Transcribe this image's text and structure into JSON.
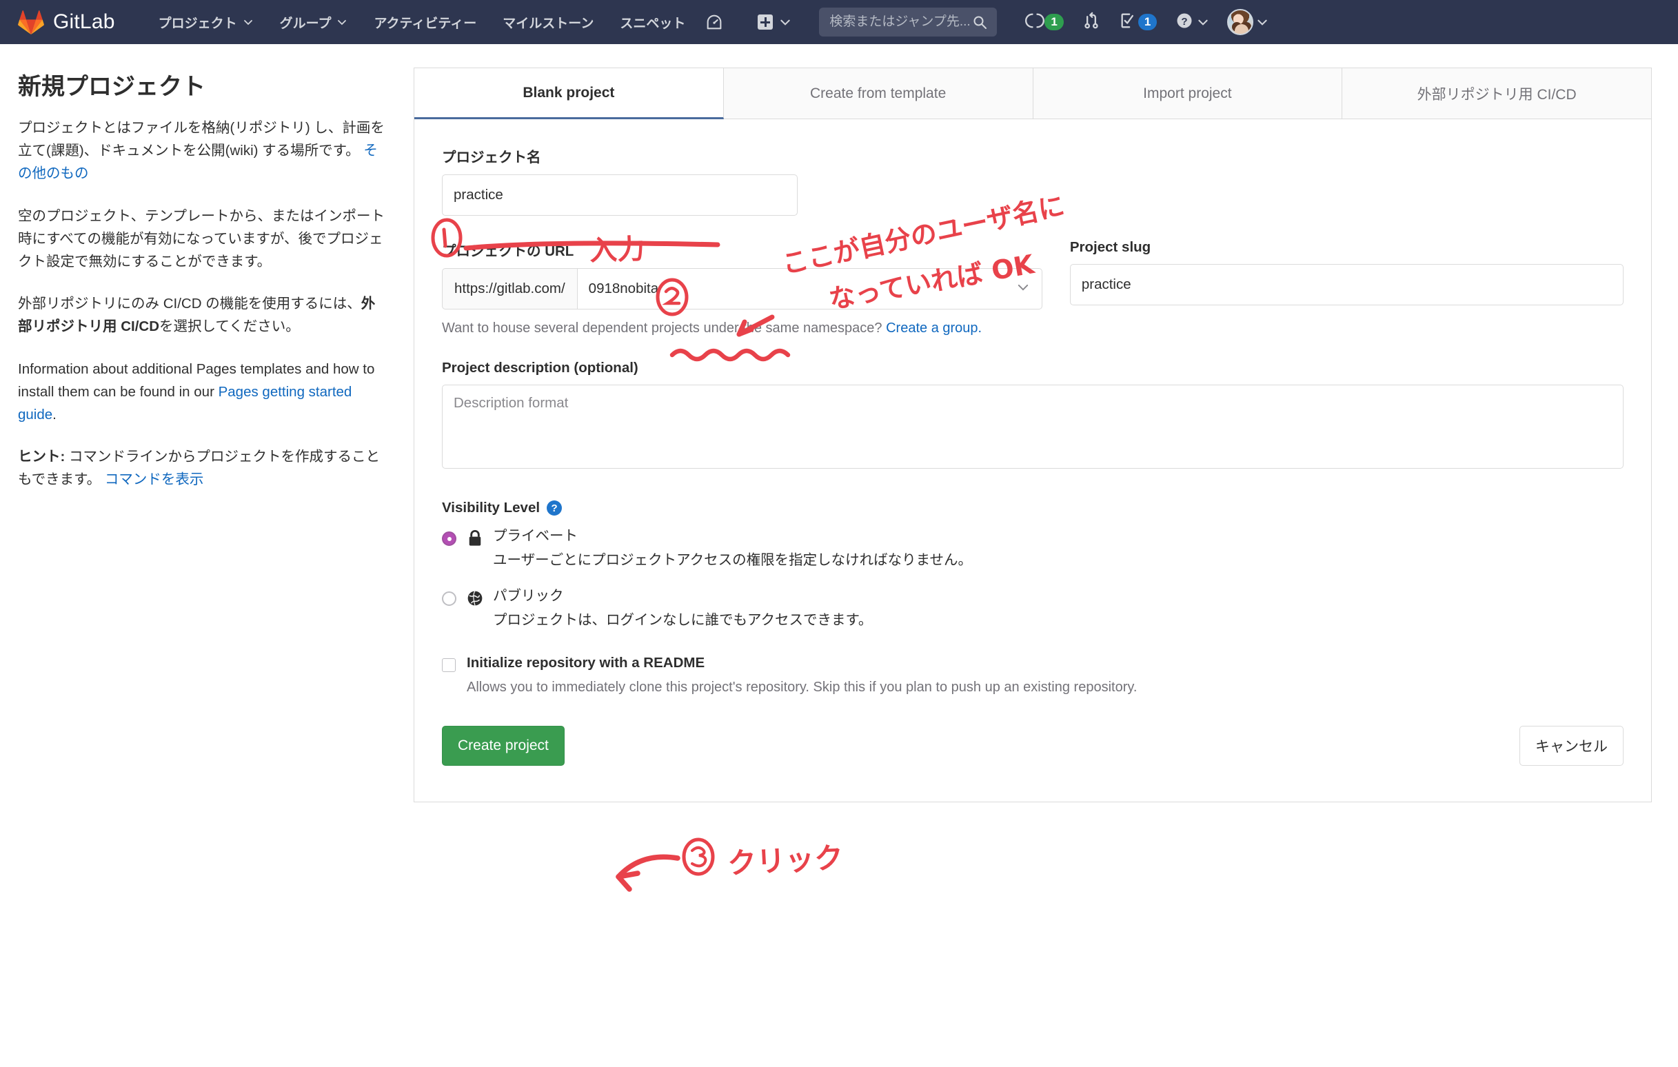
{
  "navbar": {
    "brand": "GitLab",
    "brand_icon": "gitlab-tanuki-logo",
    "links": [
      {
        "label": "プロジェクト",
        "has_caret": true
      },
      {
        "label": "グループ",
        "has_caret": true
      },
      {
        "label": "アクティビティー",
        "has_caret": false
      },
      {
        "label": "マイルストーン",
        "has_caret": false
      },
      {
        "label": "スニペット",
        "has_caret": false
      }
    ],
    "dashboard_icon": "speedometer-icon",
    "create_new_icon": "plus-square-icon",
    "search": {
      "placeholder": "検索またはジャンプ先...",
      "value": "",
      "icon": "search-icon"
    },
    "right_items": [
      {
        "name": "issues-icon",
        "badge": "1",
        "badge_color": "#2e9e4f"
      },
      {
        "name": "merge-requests-icon",
        "badge": "",
        "badge_color": ""
      },
      {
        "name": "todos-icon",
        "badge": "1",
        "badge_color": "#1f75cb"
      },
      {
        "name": "help-icon",
        "badge": "",
        "badge_color": ""
      },
      {
        "name": "user-avatar",
        "badge": "",
        "badge_color": ""
      }
    ]
  },
  "sidebar": {
    "title": "新規プロジェクト",
    "p1_a": "プロジェクトとはファイルを格納(リポジトリ) し、計画を立て(課題)、ドキュメントを公開(wiki) する場所です。",
    "p1_link": "その他のもの",
    "p2": "空のプロジェクト、テンプレートから、またはインポート時にすべての機能が有効になっていますが、後でプロジェクト設定で無効にすることができます。",
    "p3_a": "外部リポジトリにのみ CI/CD の機能を使用するには、",
    "p3_bold": "外部リポジトリ用 CI/CD",
    "p3_b": "を選択してください。",
    "p4_a": "Information about additional Pages templates and how to install them can be found in our ",
    "p4_link": "Pages getting started guide",
    "p4_b": ".",
    "p5_bold": "ヒント:",
    "p5_a": " コマンドラインからプロジェクトを作成することもできます。 ",
    "p5_link": "コマンドを表示"
  },
  "tabs": [
    {
      "label": "Blank project",
      "active": true
    },
    {
      "label": "Create from template",
      "active": false
    },
    {
      "label": "Import project",
      "active": false
    },
    {
      "label": "外部リポジトリ用 CI/CD",
      "active": false
    }
  ],
  "form": {
    "project_name_label": "プロジェクト名",
    "project_name_value": "practice",
    "project_name_placeholder": "",
    "project_url_label": "プロジェクトの URL",
    "url_prefix": "https://gitlab.com/",
    "namespace_value": "0918nobita",
    "namespace_caret_icon": "chevron-down-icon",
    "project_slug_label": "Project slug",
    "project_slug_value": "practice",
    "helper_text": "Want to house several dependent projects under the same namespace? ",
    "helper_link": "Create a group.",
    "description_label": "Project description (optional)",
    "description_value": "",
    "description_placeholder": "Description format",
    "visibility_label": "Visibility Level",
    "visibility_help_icon": "question-circle-icon",
    "visibility_options": [
      {
        "icon": "lock-icon",
        "title": "プライベート",
        "desc": "ユーザーごとにプロジェクトアクセスの権限を指定しなければなりません。",
        "selected": true
      },
      {
        "icon": "globe-icon",
        "title": "パブリック",
        "desc": "プロジェクトは、ログインなしに誰でもアクセスできます。",
        "selected": false
      }
    ],
    "readme_label": "Initialize repository with a README",
    "readme_desc": "Allows you to immediately clone this project's repository. Skip this if you plan to push up an existing repository.",
    "readme_checked": false,
    "create_button": "Create project",
    "cancel_button": "キャンセル"
  },
  "annotations": {
    "color": "#e8424a",
    "marker_1": "①",
    "marker_1_text": "入力",
    "marker_2": "②",
    "marker_2_text_line1": "ここが自分のユーザ名に",
    "marker_2_text_line2": "なっていれば OK",
    "marker_3": "③",
    "marker_3_text": "クリック"
  },
  "colors": {
    "navbar_bg": "#2e3650",
    "accent_blue": "#1068bf",
    "create_green": "#3a9c50",
    "annotation_red": "#e8424a",
    "private_radio": "#b44fb4"
  }
}
